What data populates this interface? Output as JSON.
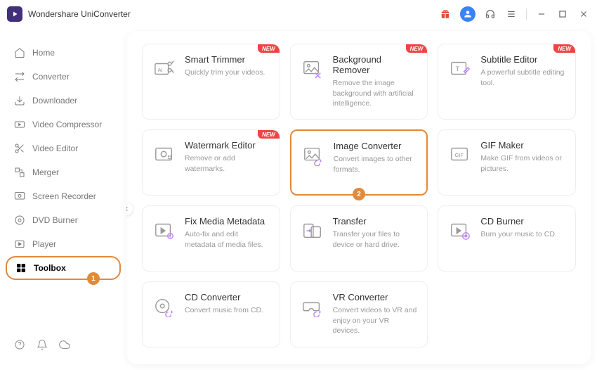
{
  "app": {
    "title": "Wondershare UniConverter"
  },
  "sidebar": {
    "items": [
      {
        "label": "Home"
      },
      {
        "label": "Converter"
      },
      {
        "label": "Downloader"
      },
      {
        "label": "Video Compressor"
      },
      {
        "label": "Video Editor"
      },
      {
        "label": "Merger"
      },
      {
        "label": "Screen Recorder"
      },
      {
        "label": "DVD Burner"
      },
      {
        "label": "Player"
      },
      {
        "label": "Toolbox"
      }
    ]
  },
  "callouts": {
    "sidebar": "1",
    "highlight": "2"
  },
  "badges": {
    "new": "NEW"
  },
  "tools": [
    {
      "title": "Smart Trimmer",
      "desc": "Quickly trim your videos.",
      "new": true
    },
    {
      "title": "Background Remover",
      "desc": "Remove the image background with artificial intelligence.",
      "new": true
    },
    {
      "title": "Subtitle Editor",
      "desc": "A powerful subtitle editing tool.",
      "new": true
    },
    {
      "title": "Watermark Editor",
      "desc": "Remove or add watermarks.",
      "new": true
    },
    {
      "title": "Image Converter",
      "desc": "Convert images to other formats.",
      "new": false,
      "highlight": true
    },
    {
      "title": "GIF Maker",
      "desc": "Make GIF from videos or pictures.",
      "new": false
    },
    {
      "title": "Fix Media Metadata",
      "desc": "Auto-fix and edit metadata of media files.",
      "new": false
    },
    {
      "title": "Transfer",
      "desc": "Transfer your files to device or hard drive.",
      "new": false
    },
    {
      "title": "CD Burner",
      "desc": "Burn your music to CD.",
      "new": false
    },
    {
      "title": "CD Converter",
      "desc": "Convert music from CD.",
      "new": false
    },
    {
      "title": "VR Converter",
      "desc": "Convert videos to VR and enjoy on your VR devices.",
      "new": false
    }
  ]
}
